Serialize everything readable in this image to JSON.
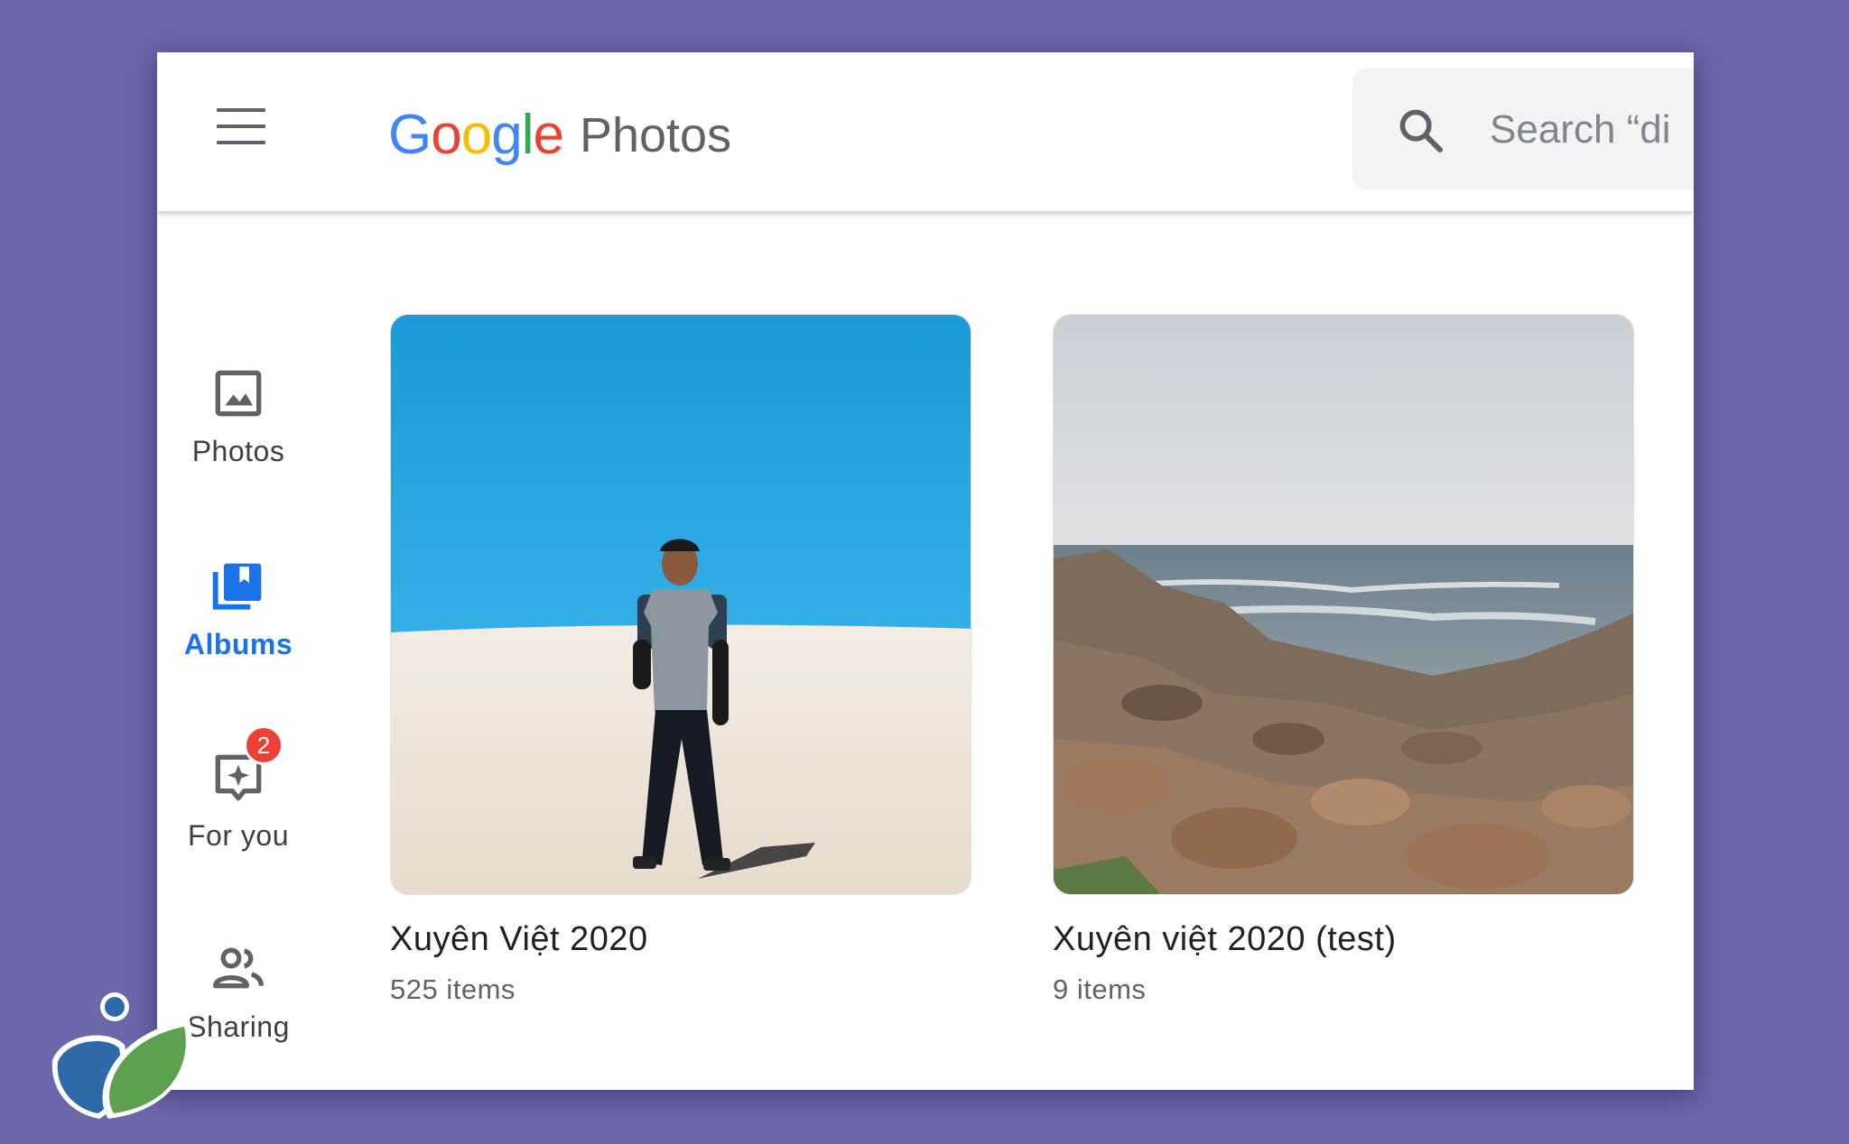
{
  "header": {
    "menu_icon": "hamburger-menu-icon",
    "logo": {
      "google_letters": [
        {
          "ch": "G",
          "color": "#4285F4"
        },
        {
          "ch": "o",
          "color": "#EA4335"
        },
        {
          "ch": "o",
          "color": "#FBBC05"
        },
        {
          "ch": "g",
          "color": "#4285F4"
        },
        {
          "ch": "l",
          "color": "#34A853"
        },
        {
          "ch": "e",
          "color": "#EA4335"
        }
      ],
      "product": "Photos"
    },
    "search": {
      "icon": "search-icon",
      "placeholder": "Search “di"
    }
  },
  "sidebar": {
    "items": [
      {
        "label": "Photos",
        "icon": "photo-icon",
        "active": false
      },
      {
        "label": "Albums",
        "icon": "albums-icon",
        "active": true
      },
      {
        "label": "For you",
        "icon": "for-you-sparkle-icon",
        "active": false,
        "badge": "2"
      },
      {
        "label": "Sharing",
        "icon": "people-icon",
        "active": false
      }
    ]
  },
  "albums": [
    {
      "title": "Xuyên Việt 2020",
      "count": "525 items"
    },
    {
      "title": "Xuyên việt 2020 (test)",
      "count": "9 items"
    }
  ],
  "colors": {
    "accent": "#1a73e8",
    "icon_gray": "#5f6368",
    "badge_red": "#ea4335",
    "background_purple": "#6b67aa"
  }
}
